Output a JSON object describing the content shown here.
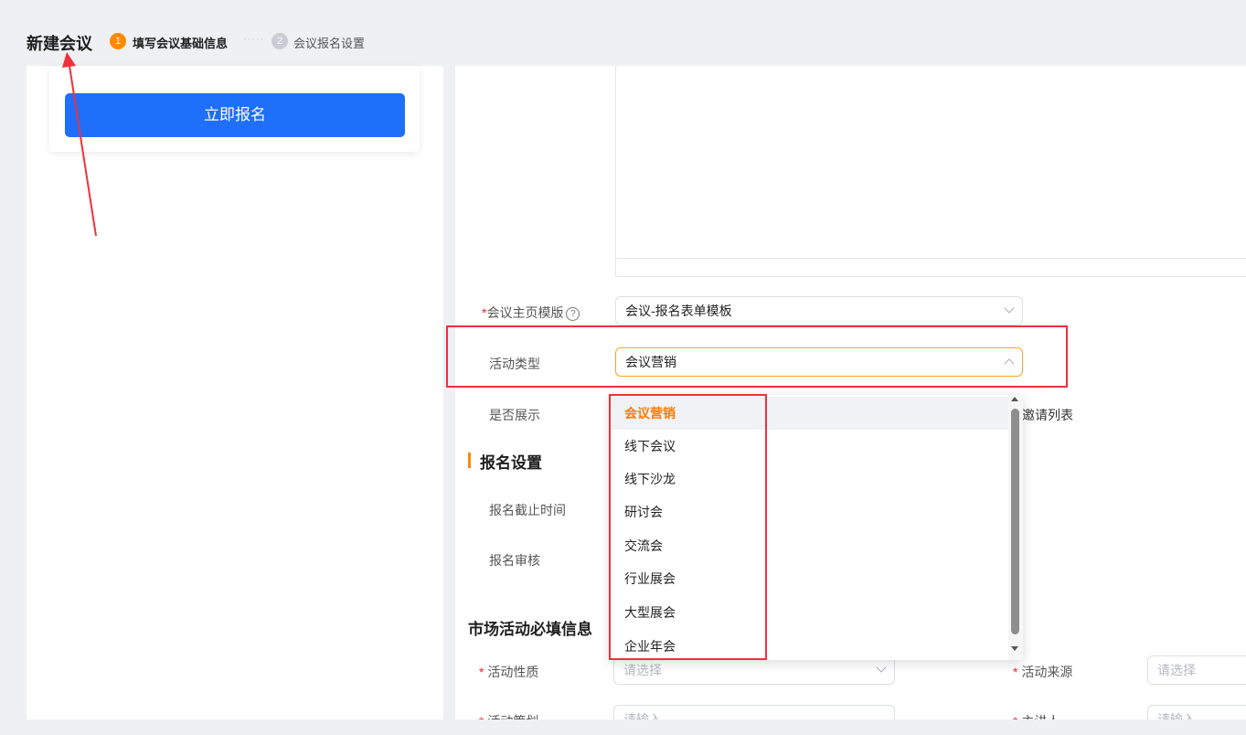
{
  "header": {
    "title": "新建会议",
    "steps": [
      {
        "number": "1",
        "label": "填写会议基础信息"
      },
      {
        "number": "2",
        "label": "会议报名设置"
      }
    ]
  },
  "preview": {
    "signup_button": "立即报名"
  },
  "form": {
    "template": {
      "required_mark": "*",
      "label": "会议主页模版",
      "help_icon": "?",
      "value": "会议-报名表单模板"
    },
    "activity_type": {
      "label": "活动类型",
      "value": "会议营销"
    },
    "show": {
      "label": "是否展示",
      "trailing_text": "邀请列表"
    },
    "signup_section": {
      "title": "报名设置",
      "deadline_label": "报名截止时间",
      "review_label": "报名审核"
    },
    "market_section": {
      "title": "市场活动必填信息",
      "nature": {
        "required_mark": "*",
        "label": "活动性质",
        "placeholder": "请选择"
      },
      "source": {
        "required_mark": "*",
        "label": "活动来源",
        "placeholder": "请选择"
      },
      "planner": {
        "required_mark": "*",
        "label": "活动策划",
        "placeholder": "请输入"
      },
      "speaker": {
        "required_mark": "*",
        "label": "主讲人",
        "placeholder": "请输入"
      }
    }
  },
  "dropdown": {
    "options": [
      "会议营销",
      "线下会议",
      "线下沙龙",
      "研讨会",
      "交流会",
      "行业展会",
      "大型展会",
      "企业年会"
    ],
    "selected": "会议营销"
  },
  "colors": {
    "accent": "#ff8a00",
    "primary_button": "#1e6ffa",
    "annotation": "#f0303b"
  }
}
